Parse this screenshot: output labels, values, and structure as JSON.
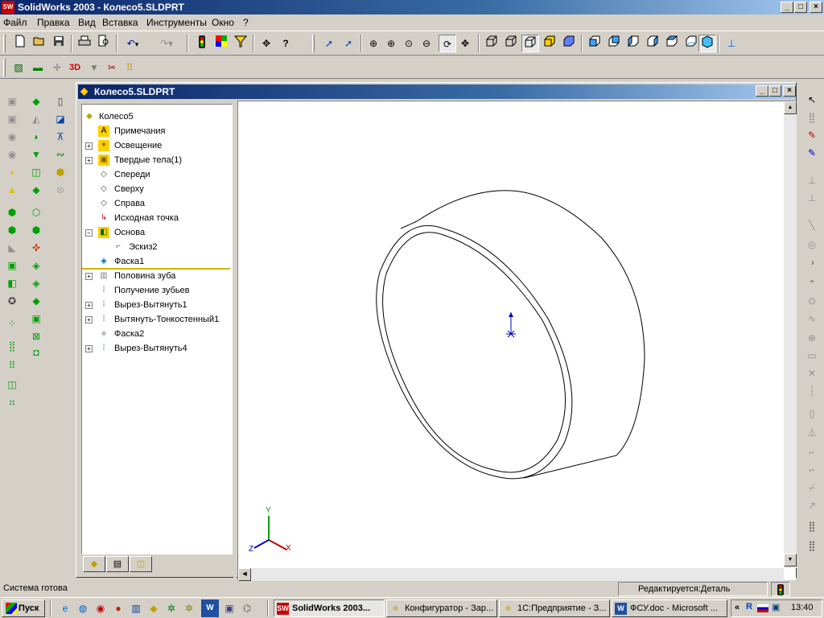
{
  "app": {
    "title": "SolidWorks 2003 - Колесо5.SLDPRT",
    "logo_text": "SW",
    "window_controls": [
      "_",
      "□",
      "×"
    ]
  },
  "menu": [
    "Файл",
    "Правка",
    "Вид",
    "Вставка",
    "Инструменты",
    "Окно",
    "?"
  ],
  "toolbar1": {
    "buttons": [
      "new-icon",
      "open-icon",
      "save-icon",
      "print-icon",
      "print-preview-icon",
      "undo-icon",
      "redo-icon",
      "rebuild-icon",
      "options-icon",
      "select-filter-icon",
      "help-whats-this-icon",
      "help-icon",
      "select-icon",
      "zoom-previous-icon",
      "zoom-fit-icon",
      "zoom-in-icon",
      "zoom-area-icon",
      "zoom-out-icon",
      "rotate-icon",
      "pan-icon",
      "wireframe-icon",
      "hidden-lines-visible-icon",
      "hidden-lines-removed-icon",
      "shaded-icon",
      "perspective-icon",
      "view-front-icon",
      "view-back-icon",
      "view-left-icon",
      "view-right-icon",
      "view-top-icon",
      "view-isometric-icon",
      "normal-to-icon"
    ],
    "undo_arrow": "▾"
  },
  "document": {
    "title": "Колесо5.SLDPRT",
    "window_controls": [
      "_",
      "□",
      "×"
    ]
  },
  "tree": {
    "root": "Колесо5",
    "items": [
      {
        "label": "Примечания",
        "icon": "annotations-icon",
        "expander": ""
      },
      {
        "label": "Освещение",
        "icon": "lighting-icon",
        "expander": "+"
      },
      {
        "label": "Твердые тела(1)",
        "icon": "solid-bodies-icon",
        "expander": "+"
      },
      {
        "label": "Спереди",
        "icon": "plane-icon",
        "expander": ""
      },
      {
        "label": "Сверху",
        "icon": "plane-icon",
        "expander": ""
      },
      {
        "label": "Справа",
        "icon": "plane-icon",
        "expander": ""
      },
      {
        "label": "Исходная точка",
        "icon": "origin-icon",
        "expander": ""
      },
      {
        "label": "Основа",
        "icon": "extrude-icon",
        "expander": "−"
      },
      {
        "label": "Эскиз2",
        "icon": "sketch-icon",
        "expander": ""
      },
      {
        "label": "Фаска1",
        "icon": "chamfer-icon",
        "expander": ""
      },
      {
        "label": "Половина зуба",
        "icon": "feature-folder-icon",
        "expander": "+"
      },
      {
        "label": "Получение зубьев",
        "icon": "pattern-icon",
        "expander": ""
      },
      {
        "label": "Вырез-Вытянуть1",
        "icon": "cut-extrude-icon",
        "expander": "+"
      },
      {
        "label": "Вытянуть-Тонкостенный1",
        "icon": "thin-extrude-icon",
        "expander": "+"
      },
      {
        "label": "Фаска2",
        "icon": "chamfer-suppressed-icon",
        "expander": ""
      },
      {
        "label": "Вырез-Вытянуть4",
        "icon": "cut-extrude-icon",
        "expander": "+"
      }
    ],
    "tabs": [
      "feature-manager-tab-icon",
      "property-manager-tab-icon",
      "configuration-manager-tab-icon"
    ]
  },
  "triad": {
    "x": "X",
    "y": "Y",
    "z": "Z"
  },
  "status": {
    "left": "Система готова",
    "right": "Редактируется:Деталь"
  },
  "taskbar": {
    "start": "Пуск",
    "tasks": [
      {
        "label": "SolidWorks 2003...",
        "icon": "solidworks-icon",
        "active": true
      },
      {
        "label": "Конфигуратор - Зар...",
        "icon": "configurator-icon",
        "active": false
      },
      {
        "label": "1С:Предприятие - З...",
        "icon": "1c-icon",
        "active": false
      },
      {
        "label": "ФСУ.doc - Microsoft ...",
        "icon": "word-icon",
        "active": false
      }
    ],
    "tray_chevron": "«",
    "clock": "13:40"
  }
}
